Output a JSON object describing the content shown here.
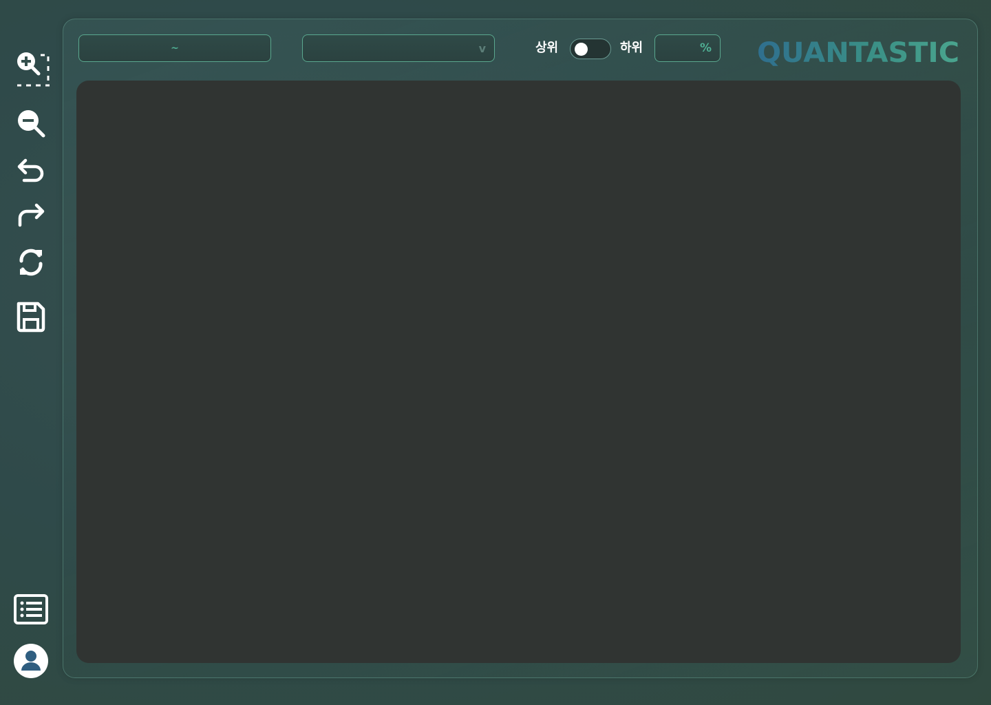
{
  "toolbar": {
    "date_range": {
      "separator": "~",
      "start": "",
      "end": ""
    },
    "dropdown": {
      "selected": "",
      "chevron": "v"
    },
    "toggle": {
      "left_label": "상위",
      "right_label": "하위",
      "state": "left"
    },
    "percent": {
      "value": "",
      "unit": "%"
    },
    "logo": {
      "text": "QUANTASTIC",
      "colors": [
        "#2f6f8f",
        "#3a8f86",
        "#4aa58e"
      ]
    }
  },
  "sidebar": {
    "top_tools": [
      {
        "name": "zoom-in-selection-icon"
      },
      {
        "name": "zoom-out-icon"
      },
      {
        "name": "undo-icon"
      },
      {
        "name": "redo-icon"
      },
      {
        "name": "refresh-icon"
      },
      {
        "name": "save-icon"
      }
    ],
    "bottom_tools": [
      {
        "name": "list-icon"
      },
      {
        "name": "user-icon"
      }
    ]
  },
  "colors": {
    "accent": "#4fae93",
    "border": "#5aa88f",
    "chart_bg": "#303432",
    "icon": "#ffffff"
  }
}
